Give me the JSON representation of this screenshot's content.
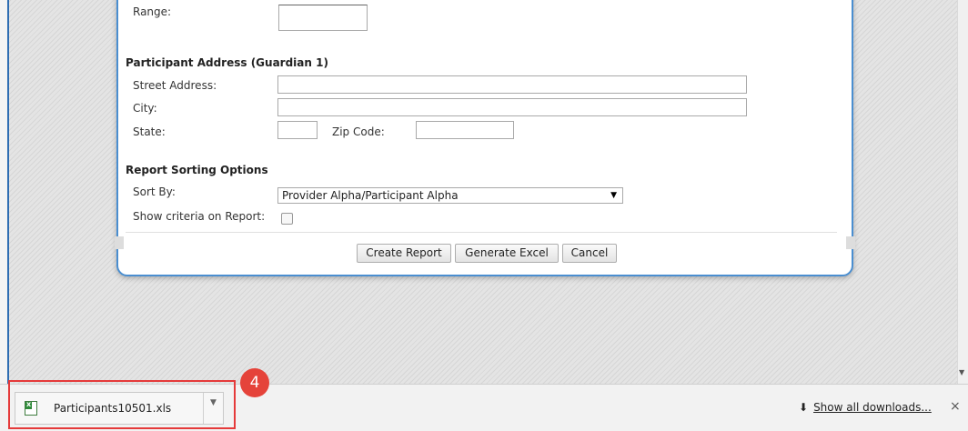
{
  "form": {
    "range_label": "Range:",
    "address_header": "Participant Address (Guardian 1)",
    "street_label": "Street Address:",
    "city_label": "City:",
    "state_label": "State:",
    "zip_label": "Zip Code:",
    "sorting_header": "Report Sorting Options",
    "sort_by_label": "Sort By:",
    "sort_by_value": "Provider Alpha/Participant Alpha",
    "show_criteria_label": "Show criteria on Report:",
    "show_criteria_checked": false
  },
  "buttons": {
    "create_report": "Create Report",
    "generate_excel": "Generate Excel",
    "cancel": "Cancel"
  },
  "download_bar": {
    "file_name": "Participants10501.xls",
    "show_all": "Show all downloads...",
    "close": "×"
  },
  "annotation": {
    "badge_number": "4",
    "highlight_color": "#e53a3a"
  },
  "colors": {
    "dialog_border": "#4a8ed0",
    "excel_green": "#2e8b3a"
  }
}
